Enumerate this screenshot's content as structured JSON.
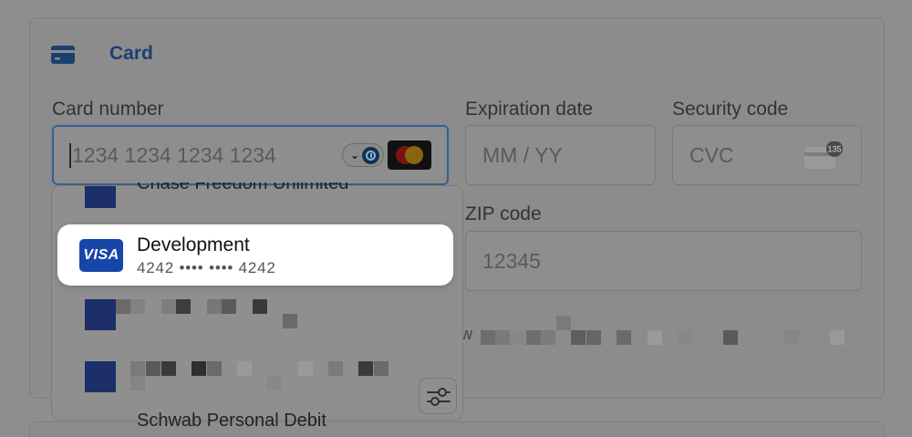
{
  "payment_method": {
    "tab_label": "Card",
    "tab_icon": "card-icon"
  },
  "form": {
    "card_number": {
      "label": "Card number",
      "placeholder": "1234 1234 1234 1234"
    },
    "expiration": {
      "label": "Expiration date",
      "placeholder": "MM / YY"
    },
    "security_code": {
      "label": "Security code",
      "placeholder": "CVC",
      "icon_badge": "135"
    },
    "zip": {
      "label": "ZIP code",
      "placeholder": "12345"
    }
  },
  "autofill": {
    "selected_item": {
      "brand": "VISA",
      "name": "Development",
      "masked_number": "4242 •••• •••• 4242"
    },
    "partial_bottom_item": "Schwab Personal Debit",
    "partial_top_item": "Chase Freedom Unlimited"
  },
  "colors": {
    "accent": "#1c3f72",
    "visa_blue": "#1746a8",
    "highlight_bg": "#ffffff"
  }
}
